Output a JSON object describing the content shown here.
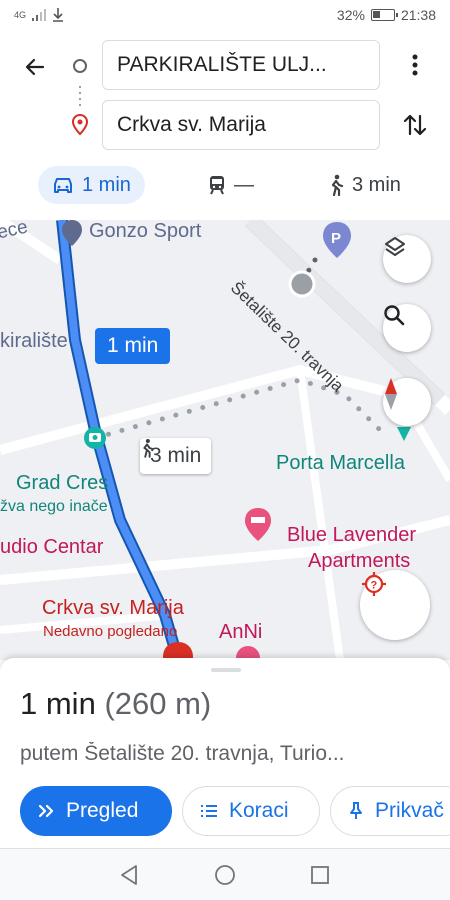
{
  "status_bar": {
    "network": "4G",
    "battery": "32%",
    "time": "21:38"
  },
  "directions": {
    "origin": "PARKIRALIŠTE ULJ...",
    "destination": "Crkva sv. Marija"
  },
  "modes": {
    "drive": "1 min",
    "transit": "—",
    "walk": "3 min"
  },
  "map": {
    "labels": {
      "gonzo_sport": "Gonzo Sport",
      "street_partial": "tece",
      "setaliste": "Šetalište 20. travnja",
      "parkiraliste": "kiralište",
      "grad_cres": "Grad Cres",
      "grad_cres_sub": "žva nego inače",
      "porta_marcella": "Porta Marcella",
      "blue_lavender_1": "Blue Lavender",
      "blue_lavender_2": "Apartments",
      "studio_center": "udio Centar",
      "crkva": "Crkva sv. Marija",
      "recently_viewed": "Nedavno pogledano",
      "anni": "AnNi"
    },
    "route_callout": "1 min",
    "walk_callout": "3 min"
  },
  "sheet": {
    "duration": "1 min",
    "distance": "(260 m)",
    "via": "putem Šetalište 20. travnja, Turio...",
    "preview_btn": "Pregled",
    "steps_btn": "Koraci",
    "pin_btn": "Prikvač"
  },
  "colors": {
    "accent": "#1a73e8",
    "route": "#1a73e8",
    "teal_poi": "#12857a",
    "pink_poi": "#c2185b"
  }
}
